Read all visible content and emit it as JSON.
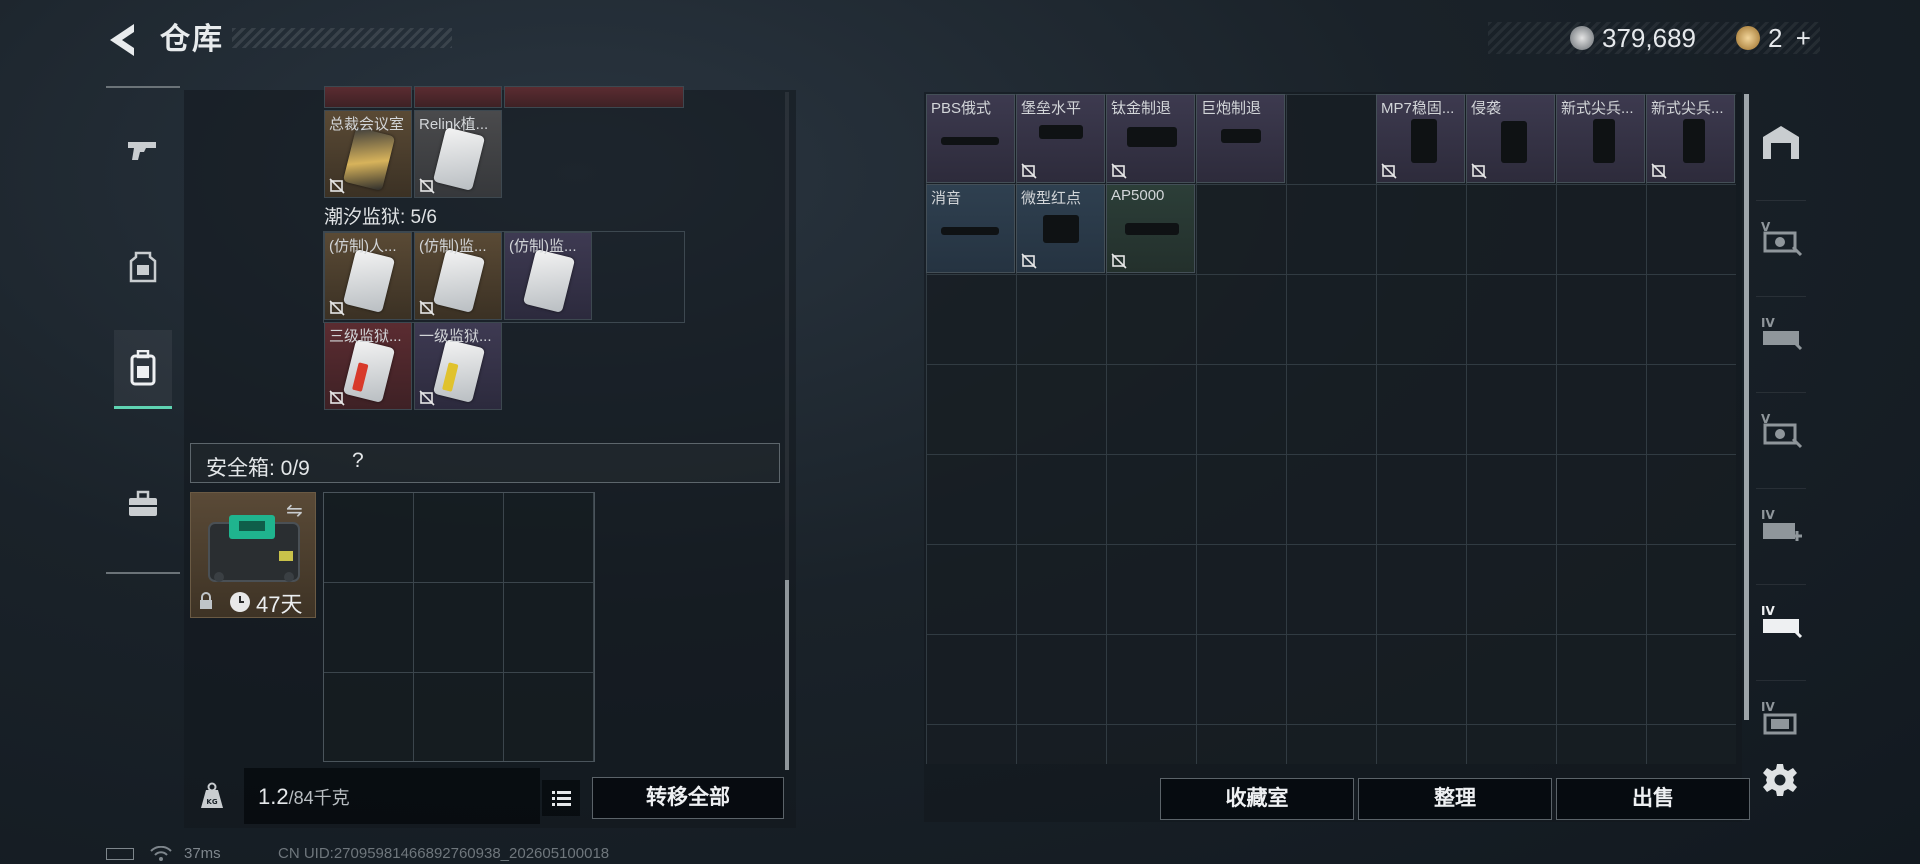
{
  "header": {
    "title": "仓库",
    "currency_amount": "379,689",
    "premium_amount": "2",
    "premium_add": "+"
  },
  "left": {
    "top_row_cards": [
      {
        "label": "总裁会议室",
        "bg": "gold"
      },
      {
        "label": "Relink植...",
        "bg": "gray"
      }
    ],
    "prison_label": "潮汐监狱: 5/6",
    "prison_cards": [
      {
        "label": "(仿制)人...",
        "bg": "gold"
      },
      {
        "label": "(仿制)监...",
        "bg": "gold"
      },
      {
        "label": "(仿制)监...",
        "bg": "purple"
      },
      {
        "label": "三级监狱...",
        "bg": "red"
      },
      {
        "label": "一级监狱...",
        "bg": "purple"
      }
    ],
    "safebox_label": "安全箱: 0/9",
    "safebox_help": "?",
    "safebox_swap": "⇋",
    "safebox_time": "47天",
    "weight_value": "1.2",
    "weight_max": "/84千克",
    "transfer_all": "转移全部"
  },
  "right": {
    "items": [
      {
        "label": "PBS俄式",
        "col": 0,
        "row": 0,
        "bg": "purple",
        "locked": false
      },
      {
        "label": "堡垒水平",
        "col": 1,
        "row": 0,
        "bg": "purple",
        "locked": true
      },
      {
        "label": "钛金制退",
        "col": 2,
        "row": 0,
        "bg": "purple",
        "locked": true
      },
      {
        "label": "巨炮制退",
        "col": 3,
        "row": 0,
        "bg": "purple",
        "locked": false
      },
      {
        "label": "MP7稳固...",
        "col": 5,
        "row": 0,
        "bg": "purple",
        "locked": true
      },
      {
        "label": "侵袭",
        "col": 6,
        "row": 0,
        "bg": "purple",
        "locked": true
      },
      {
        "label": "新式尖兵...",
        "col": 7,
        "row": 0,
        "bg": "purple",
        "locked": false
      },
      {
        "label": "新式尖兵...",
        "col": 8,
        "row": 0,
        "bg": "purple",
        "locked": true
      },
      {
        "label": "消音",
        "col": 0,
        "row": 1,
        "bg": "blue",
        "locked": false
      },
      {
        "label": "微型红点",
        "col": 1,
        "row": 1,
        "bg": "blue",
        "locked": true
      },
      {
        "label": "AP5000",
        "col": 2,
        "row": 1,
        "bg": "green",
        "locked": true
      }
    ],
    "buttons": {
      "collection": "收藏室",
      "sort": "整理",
      "sell": "出售"
    }
  },
  "status": {
    "ping": "37ms",
    "uid": "CN UID:27095981466892760938_202605100018"
  },
  "colors": {
    "accent": "#5fd3b2",
    "gold_item": "#5a4a35",
    "purple_item": "#3e3a52",
    "red_item": "#5b2c31",
    "blue_item": "#2f4050"
  }
}
